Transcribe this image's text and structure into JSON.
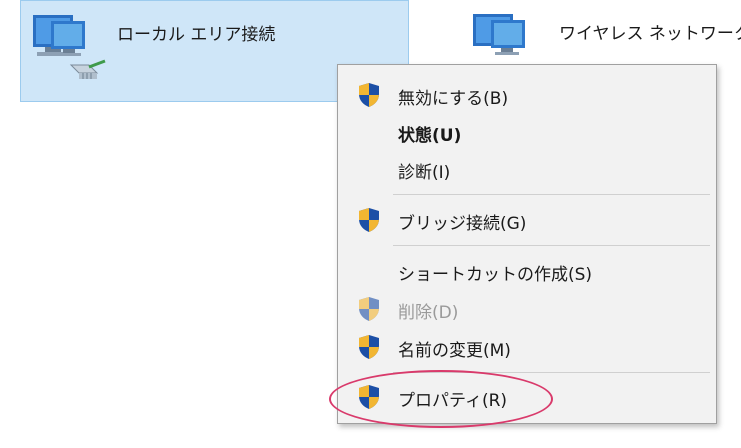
{
  "adapters": [
    {
      "name": "ローカル エリア接続",
      "selected": true
    },
    {
      "name": "ワイヤレス ネットワーク接"
    }
  ],
  "context_menu": {
    "items": [
      {
        "label": "無効にする(B)",
        "icon": "uac-shield-icon"
      },
      {
        "label": "状態(U)",
        "bold": true
      },
      {
        "label": "診断(I)"
      },
      {
        "label": "ブリッジ接続(G)",
        "icon": "uac-shield-icon"
      },
      {
        "label": "ショートカットの作成(S)"
      },
      {
        "label": "削除(D)",
        "icon": "uac-shield-icon",
        "disabled": true
      },
      {
        "label": "名前の変更(M)",
        "icon": "uac-shield-icon"
      },
      {
        "label": "プロパティ(R)",
        "icon": "uac-shield-icon",
        "highlighted": true
      }
    ]
  },
  "colors": {
    "selection_bg": "#cfe6f8",
    "menu_bg": "#f2f2f2",
    "highlight_ring": "#d93a6b"
  }
}
